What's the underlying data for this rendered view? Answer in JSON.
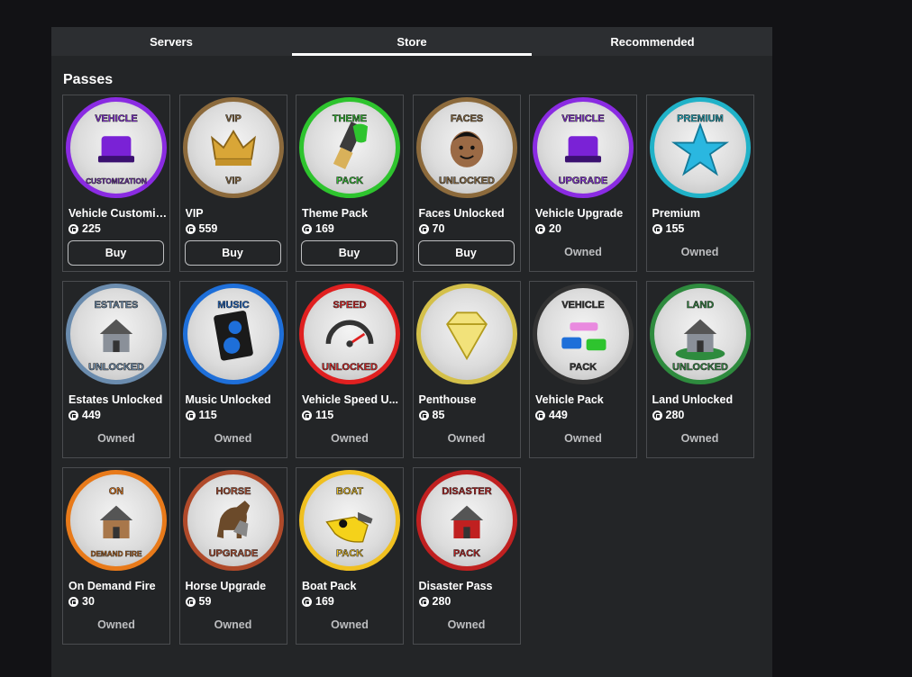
{
  "tabs": [
    {
      "label": "Servers",
      "active": false
    },
    {
      "label": "Store",
      "active": true
    },
    {
      "label": "Recommended",
      "active": false
    }
  ],
  "section_title": "Passes",
  "passes": [
    {
      "name": "Vehicle Customiz...",
      "price": "225",
      "status": "Buy",
      "ring": "#8a2be2",
      "icon": "vehicle-customization-icon",
      "top": "VEHICLE",
      "bottom": "CUSTOMIZATION"
    },
    {
      "name": "VIP",
      "price": "559",
      "status": "Buy",
      "ring": "#8c6a3c",
      "icon": "crown-icon",
      "top": "VIP",
      "bottom": "VIP"
    },
    {
      "name": "Theme Pack",
      "price": "169",
      "status": "Buy",
      "ring": "#2ec42e",
      "icon": "paintbrush-icon",
      "top": "THEME",
      "bottom": "PACK"
    },
    {
      "name": "Faces Unlocked",
      "price": "70",
      "status": "Buy",
      "ring": "#8c6a3c",
      "icon": "face-icon",
      "top": "FACES",
      "bottom": "UNLOCKED"
    },
    {
      "name": "Vehicle Upgrade",
      "price": "20",
      "status": "Owned",
      "ring": "#8a2be2",
      "icon": "car-upgrade-icon",
      "top": "VEHICLE",
      "bottom": "UPGRADE"
    },
    {
      "name": "Premium",
      "price": "155",
      "status": "Owned",
      "ring": "#20b2c8",
      "icon": "star-icon",
      "top": "PREMIUM",
      "bottom": ""
    },
    {
      "name": "Estates Unlocked",
      "price": "449",
      "status": "Owned",
      "ring": "#6b8cae",
      "icon": "house-icon",
      "top": "ESTATES",
      "bottom": "UNLOCKED"
    },
    {
      "name": "Music Unlocked",
      "price": "115",
      "status": "Owned",
      "ring": "#1e6fd9",
      "icon": "speaker-icon",
      "top": "MUSIC",
      "bottom": ""
    },
    {
      "name": "Vehicle Speed U...",
      "price": "115",
      "status": "Owned",
      "ring": "#e02020",
      "icon": "speedometer-icon",
      "top": "SPEED",
      "bottom": "UNLOCKED"
    },
    {
      "name": "Penthouse",
      "price": "85",
      "status": "Owned",
      "ring": "#d4c04a",
      "icon": "diamond-icon",
      "top": "",
      "bottom": ""
    },
    {
      "name": "Vehicle Pack",
      "price": "449",
      "status": "Owned",
      "ring": "#333333",
      "icon": "cars-icon",
      "top": "VEHICLE",
      "bottom": "PACK"
    },
    {
      "name": "Land Unlocked",
      "price": "280",
      "status": "Owned",
      "ring": "#2e8b3e",
      "icon": "land-icon",
      "top": "LAND",
      "bottom": "UNLOCKED"
    },
    {
      "name": "On Demand Fire",
      "price": "30",
      "status": "Owned",
      "ring": "#e87a1a",
      "icon": "fire-house-icon",
      "top": "ON",
      "bottom": "DEMAND FIRE"
    },
    {
      "name": "Horse Upgrade",
      "price": "59",
      "status": "Owned",
      "ring": "#b04a2a",
      "icon": "horse-icon",
      "top": "HORSE",
      "bottom": "UPGRADE"
    },
    {
      "name": "Boat Pack",
      "price": "169",
      "status": "Owned",
      "ring": "#f0c020",
      "icon": "boat-icon",
      "top": "BOAT",
      "bottom": "PACK"
    },
    {
      "name": "Disaster Pass",
      "price": "280",
      "status": "Owned",
      "ring": "#c02020",
      "icon": "disaster-house-icon",
      "top": "DISASTER",
      "bottom": "PACK"
    }
  ]
}
